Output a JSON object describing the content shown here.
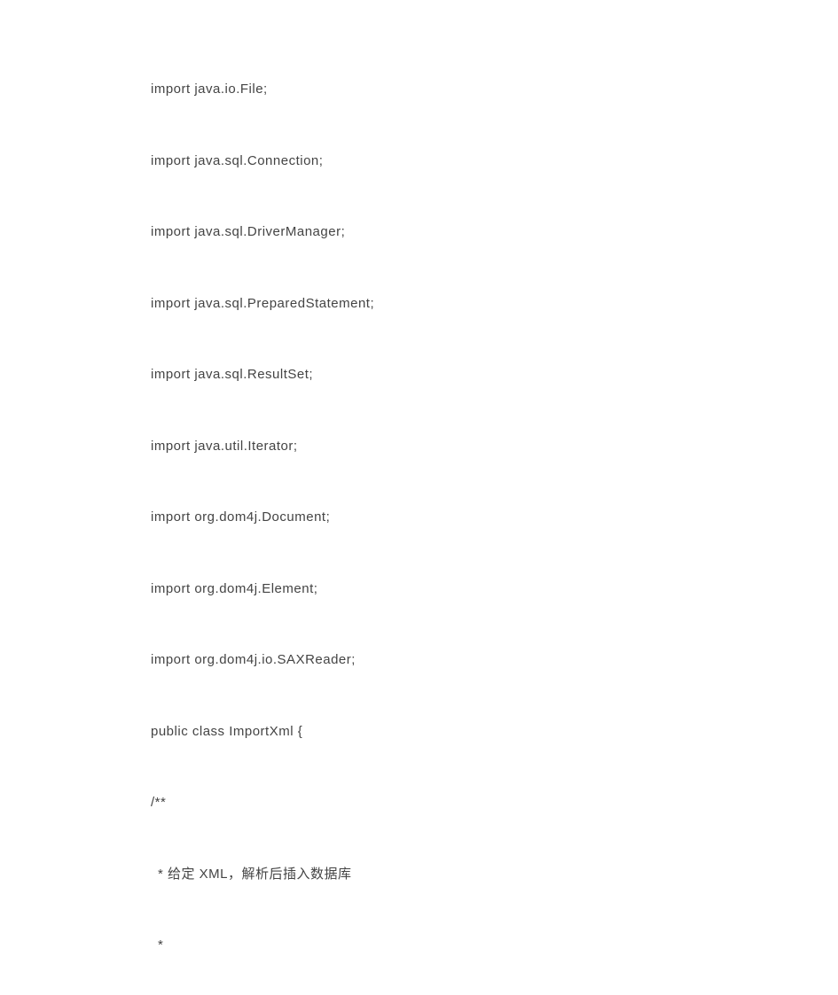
{
  "lines": [
    "import java.io.File;",
    "import java.sql.Connection;",
    "import java.sql.DriverManager;",
    "import java.sql.PreparedStatement;",
    "import java.sql.ResultSet;",
    "import java.util.Iterator;",
    "import org.dom4j.Document;",
    "import org.dom4j.Element;",
    "import org.dom4j.io.SAXReader;",
    "public class ImportXml {",
    "/**",
    " * 给定 XML，解析后插入数据库",
    " *"
  ]
}
